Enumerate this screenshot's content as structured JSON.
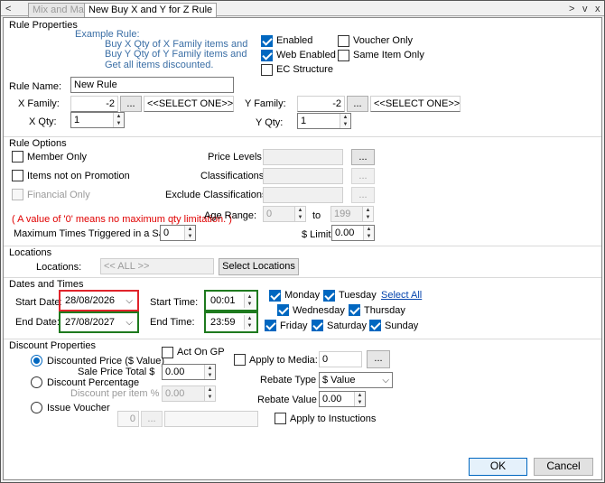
{
  "tabs": [
    {
      "label": "Mix and Match",
      "active": false
    },
    {
      "label": "New Buy X and Y for Z Rule",
      "active": true
    }
  ],
  "window_controls": {
    "prev": "<",
    "next": ">",
    "menu": "v",
    "close": "x"
  },
  "rule_properties": {
    "heading": "Rule Properties",
    "example_title": "Example Rule:",
    "example_line1": "Buy X Qty of X Family items and",
    "example_line2": "Buy Y Qty of Y Family items and",
    "example_line3": "Get all items discounted.",
    "enabled": {
      "label": "Enabled",
      "checked": true
    },
    "web_enabled": {
      "label": "Web Enabled",
      "checked": true
    },
    "ec_structure": {
      "label": "EC Structure",
      "checked": false
    },
    "voucher_only": {
      "label": "Voucher Only",
      "checked": false
    },
    "same_item_only": {
      "label": "Same Item Only",
      "checked": false
    },
    "rule_name_label": "Rule Name:",
    "rule_name_value": "New Rule",
    "x_family_label": "X Family:",
    "x_family_value": "-2",
    "x_family_select": "<<SELECT ONE>>",
    "x_qty_label": "X Qty:",
    "x_qty_value": "1",
    "y_family_label": "Y Family:",
    "y_family_value": "-2",
    "y_family_select": "<<SELECT ONE>>",
    "y_qty_label": "Y Qty:",
    "y_qty_value": "1",
    "browse_label": "..."
  },
  "rule_options": {
    "heading": "Rule Options",
    "member_only": {
      "label": "Member Only",
      "checked": false
    },
    "items_not_on_promotion": {
      "label": "Items not on Promotion",
      "checked": false
    },
    "financial_only": {
      "label": "Financial Only",
      "checked": false,
      "disabled": true
    },
    "price_levels_label": "Price Levels",
    "classifications_label": "Classifications",
    "exclude_classifications_label": "Exclude Classifications:",
    "warning": "( A value of '0' means no maximum qty limitation. )",
    "age_range_label": "Age Range:",
    "age_from": "0",
    "age_to_label": "to",
    "age_to": "199",
    "max_times_label": "Maximum Times Triggered in a Sale:",
    "max_times_value": "0",
    "limit_label": "$ Limit",
    "limit_value": "0.00",
    "browse_label": "..."
  },
  "locations": {
    "heading": "Locations",
    "label": "Locations:",
    "value": "<< ALL >>",
    "select_button": "Select Locations"
  },
  "dates": {
    "heading": "Dates and Times",
    "start_date_label": "Start Date:",
    "start_date": "28/08/2026",
    "end_date_label": "End Date:",
    "end_date": "27/08/2027",
    "start_time_label": "Start Time:",
    "start_time": "00:01",
    "end_time_label": "End Time:",
    "end_time": "23:59",
    "days": {
      "monday": {
        "label": "Monday",
        "checked": true
      },
      "tuesday": {
        "label": "Tuesday",
        "checked": true
      },
      "wednesday": {
        "label": "Wednesday",
        "checked": true
      },
      "thursday": {
        "label": "Thursday",
        "checked": true
      },
      "friday": {
        "label": "Friday",
        "checked": true
      },
      "saturday": {
        "label": "Saturday",
        "checked": true
      },
      "sunday": {
        "label": "Sunday",
        "checked": true
      }
    },
    "select_all": "Select All"
  },
  "discount": {
    "heading": "Discount Properties",
    "discounted_price": {
      "label": "Discounted Price ($ Value)",
      "selected": true
    },
    "discount_percentage": {
      "label": "Discount Percentage",
      "selected": false
    },
    "issue_voucher": {
      "label": "Issue Voucher",
      "selected": false
    },
    "act_on_gp": {
      "label": "Act On GP",
      "checked": false
    },
    "sale_price_total_label": "Sale Price Total $",
    "sale_price_total_value": "0.00",
    "discount_per_item_label": "Discount per item %",
    "discount_per_item_value": "0.00",
    "voucher_value": "0",
    "apply_to_media": {
      "label": "Apply to Media:",
      "checked": false
    },
    "media_value": "0",
    "rebate_type_label": "Rebate Type",
    "rebate_type_value": "$ Value",
    "rebate_value_label": "Rebate Value",
    "rebate_value": "0.00",
    "apply_to_instructions": {
      "label": "Apply to Instuctions",
      "checked": false
    },
    "browse_label": "..."
  },
  "footer": {
    "ok": "OK",
    "cancel": "Cancel"
  },
  "colors": {
    "accent": "#0067c0",
    "highlight_red": "#e0242b",
    "highlight_green": "#1e7a1e",
    "info_blue": "#3a6ea5",
    "warning_red": "#e00000"
  }
}
